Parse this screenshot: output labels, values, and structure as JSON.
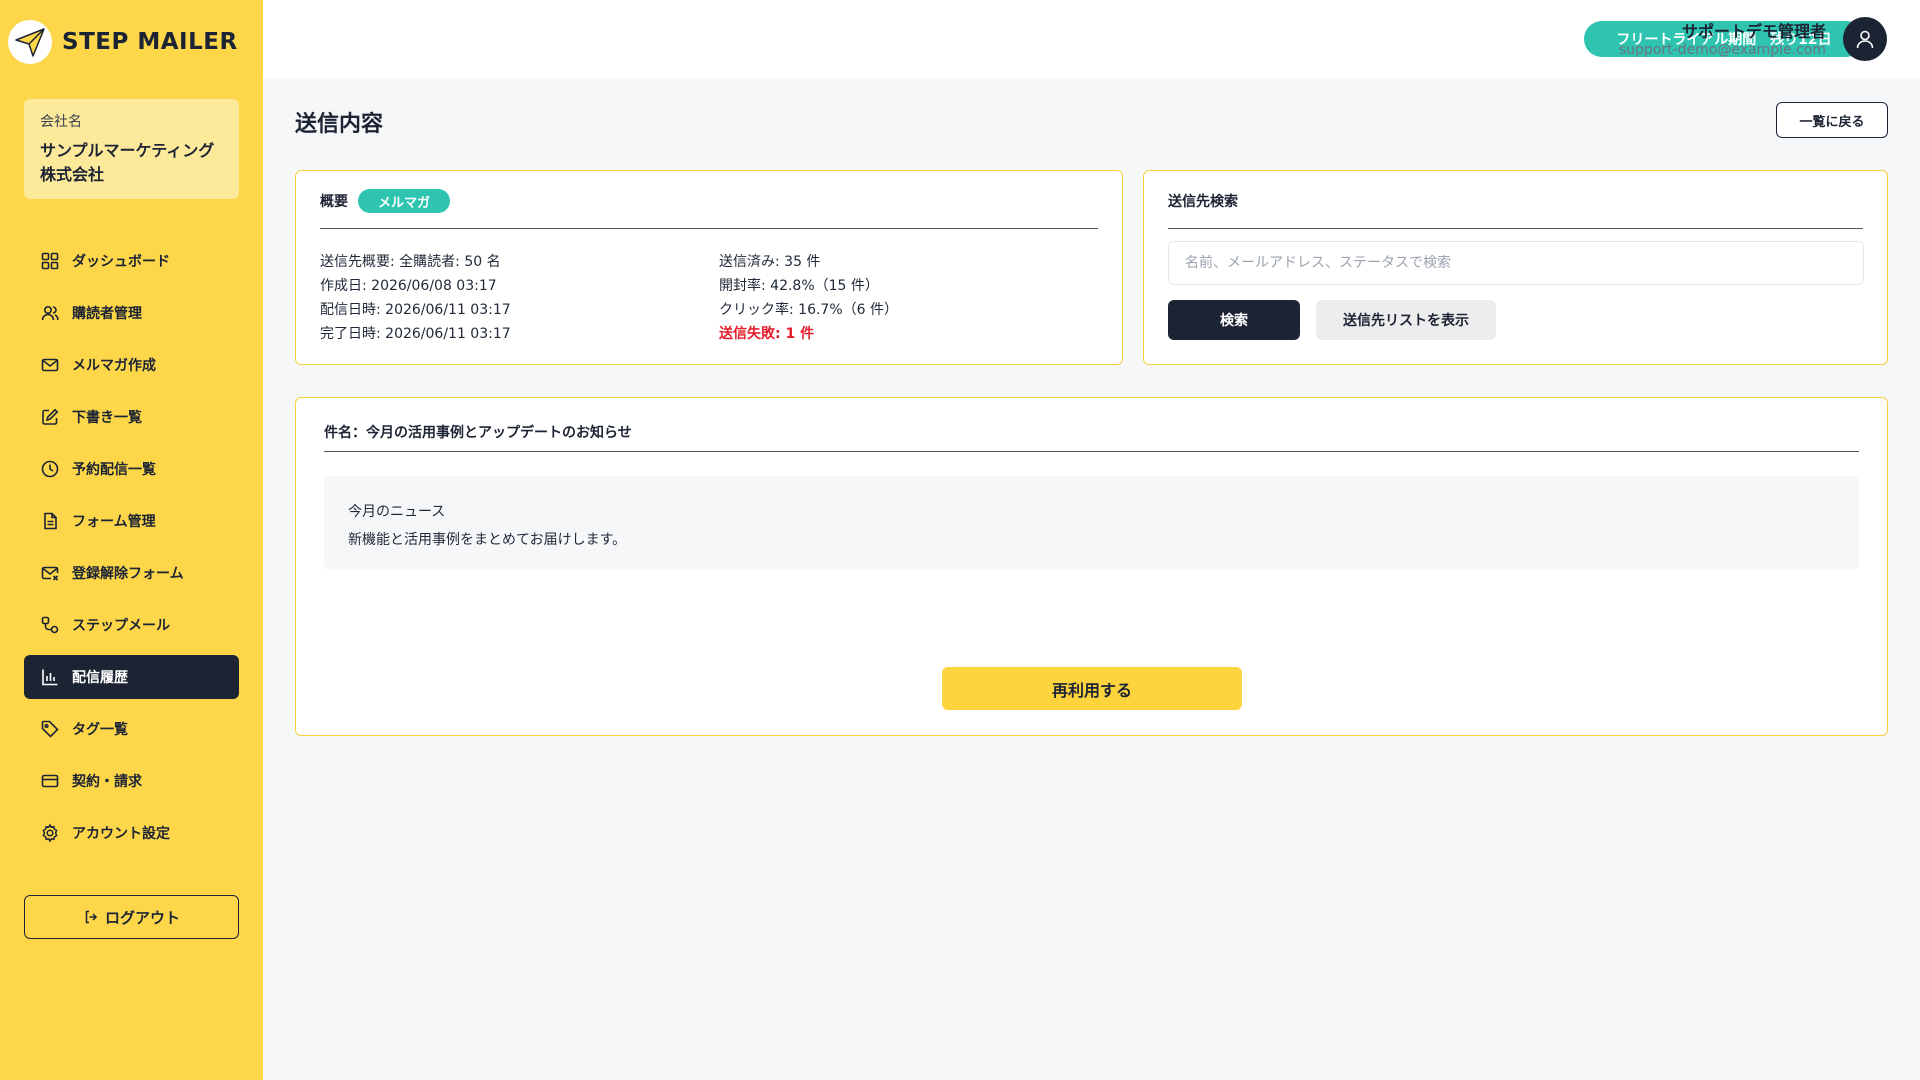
{
  "app": {
    "name": "STEP MAILER"
  },
  "company": {
    "label": "会社名",
    "name_line1": "サンプルマーケティング",
    "name_line2": "株式会社"
  },
  "sidebar": {
    "items": [
      {
        "label": "ダッシュボード",
        "icon": "dashboard-icon"
      },
      {
        "label": "購読者管理",
        "icon": "users-icon"
      },
      {
        "label": "メルマガ作成",
        "icon": "mail-icon"
      },
      {
        "label": "下書き一覧",
        "icon": "edit-icon"
      },
      {
        "label": "予約配信一覧",
        "icon": "clock-icon"
      },
      {
        "label": "フォーム管理",
        "icon": "document-icon"
      },
      {
        "label": "登録解除フォーム",
        "icon": "mail-x-icon"
      },
      {
        "label": "ステップメール",
        "icon": "step-icon"
      },
      {
        "label": "配信履歴",
        "icon": "bar-chart-icon",
        "active": true
      },
      {
        "label": "タグ一覧",
        "icon": "tag-icon"
      },
      {
        "label": "契約・請求",
        "icon": "card-icon"
      },
      {
        "label": "アカウント設定",
        "icon": "gear-icon"
      }
    ],
    "logout_label": "ログアウト"
  },
  "header": {
    "trial_label": "フリートライアル期間　残り12日",
    "user_name": "サポートデモ管理者",
    "user_email": "support-demo@example.com"
  },
  "page": {
    "title": "送信内容",
    "back_label": "一覧に戻る"
  },
  "overview": {
    "heading": "概要",
    "badge": "メルマガ",
    "left_lines": [
      "送信先概要: 全購読者: 50 名",
      "作成日: 2026/06/08 03:17",
      "配信日時: 2026/06/11 03:17",
      "完了日時: 2026/06/11 03:17"
    ],
    "right_lines": [
      "送信済み: 35 件",
      "開封率: 42.8%（15 件）",
      "クリック率: 16.7%（6 件）"
    ],
    "fail_line": "送信失敗: 1 件"
  },
  "recipients": {
    "heading": "送信先検索",
    "search_placeholder": "名前、メールアドレス、ステータスで検索",
    "search_label": "検索",
    "list_label": "送信先リストを表示"
  },
  "content": {
    "subject": "件名：今月の活用事例とアップデートのお知らせ",
    "body_lines": [
      "今月のニュース",
      "新機能と活用事例をまとめてお届けします。"
    ],
    "reuse_label": "再利用する"
  },
  "colors": {
    "sidebar": "#fdd649",
    "accent": "#2ec4b0",
    "dark": "#1c2434",
    "danger": "#e41e2b"
  }
}
